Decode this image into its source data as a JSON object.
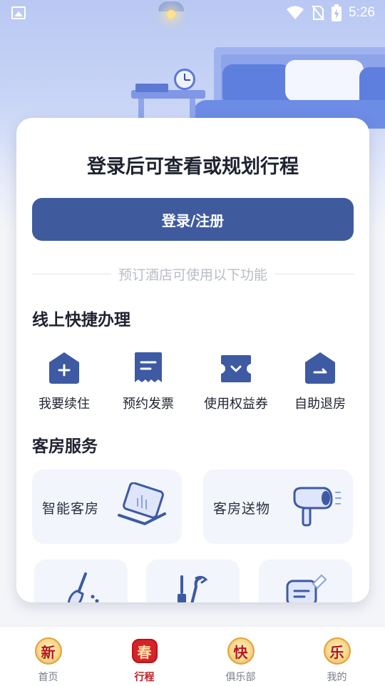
{
  "status_bar": {
    "time": "5:26",
    "icons": [
      "image-icon",
      "wifi-icon",
      "no-sim-icon",
      "battery-charging-icon"
    ]
  },
  "card": {
    "title": "登录后可查看或规划行程",
    "login_button": "登录/注册",
    "divider_text": "预订酒店可使用以下功能"
  },
  "quick_section": {
    "title": "线上快捷办理",
    "items": [
      {
        "label": "我要续住",
        "icon": "house-plus-icon"
      },
      {
        "label": "预约发票",
        "icon": "invoice-icon"
      },
      {
        "label": "使用权益券",
        "icon": "ticket-icon"
      },
      {
        "label": "自助退房",
        "icon": "house-exit-icon"
      }
    ]
  },
  "room_section": {
    "title": "客房服务",
    "tiles": [
      {
        "label": "智能客房",
        "icon": "tablet-icon"
      },
      {
        "label": "客房送物",
        "icon": "hair-dryer-icon"
      }
    ],
    "small_tiles": [
      {
        "icon": "broom-icon"
      },
      {
        "icon": "repair-tools-icon"
      },
      {
        "icon": "note-edit-icon"
      }
    ]
  },
  "bottom_nav": {
    "items": [
      {
        "label": "首页",
        "badge": "新",
        "active": false
      },
      {
        "label": "行程",
        "badge": "春",
        "active": true
      },
      {
        "label": "俱乐部",
        "badge": "快",
        "active": false
      },
      {
        "label": "我的",
        "badge": "乐",
        "active": false
      }
    ]
  },
  "colors": {
    "primary": "#3f5b9e",
    "icon_blue": "#3d5aa3",
    "tile_bg": "#f2f5fc",
    "active_nav": "#c21e24"
  }
}
